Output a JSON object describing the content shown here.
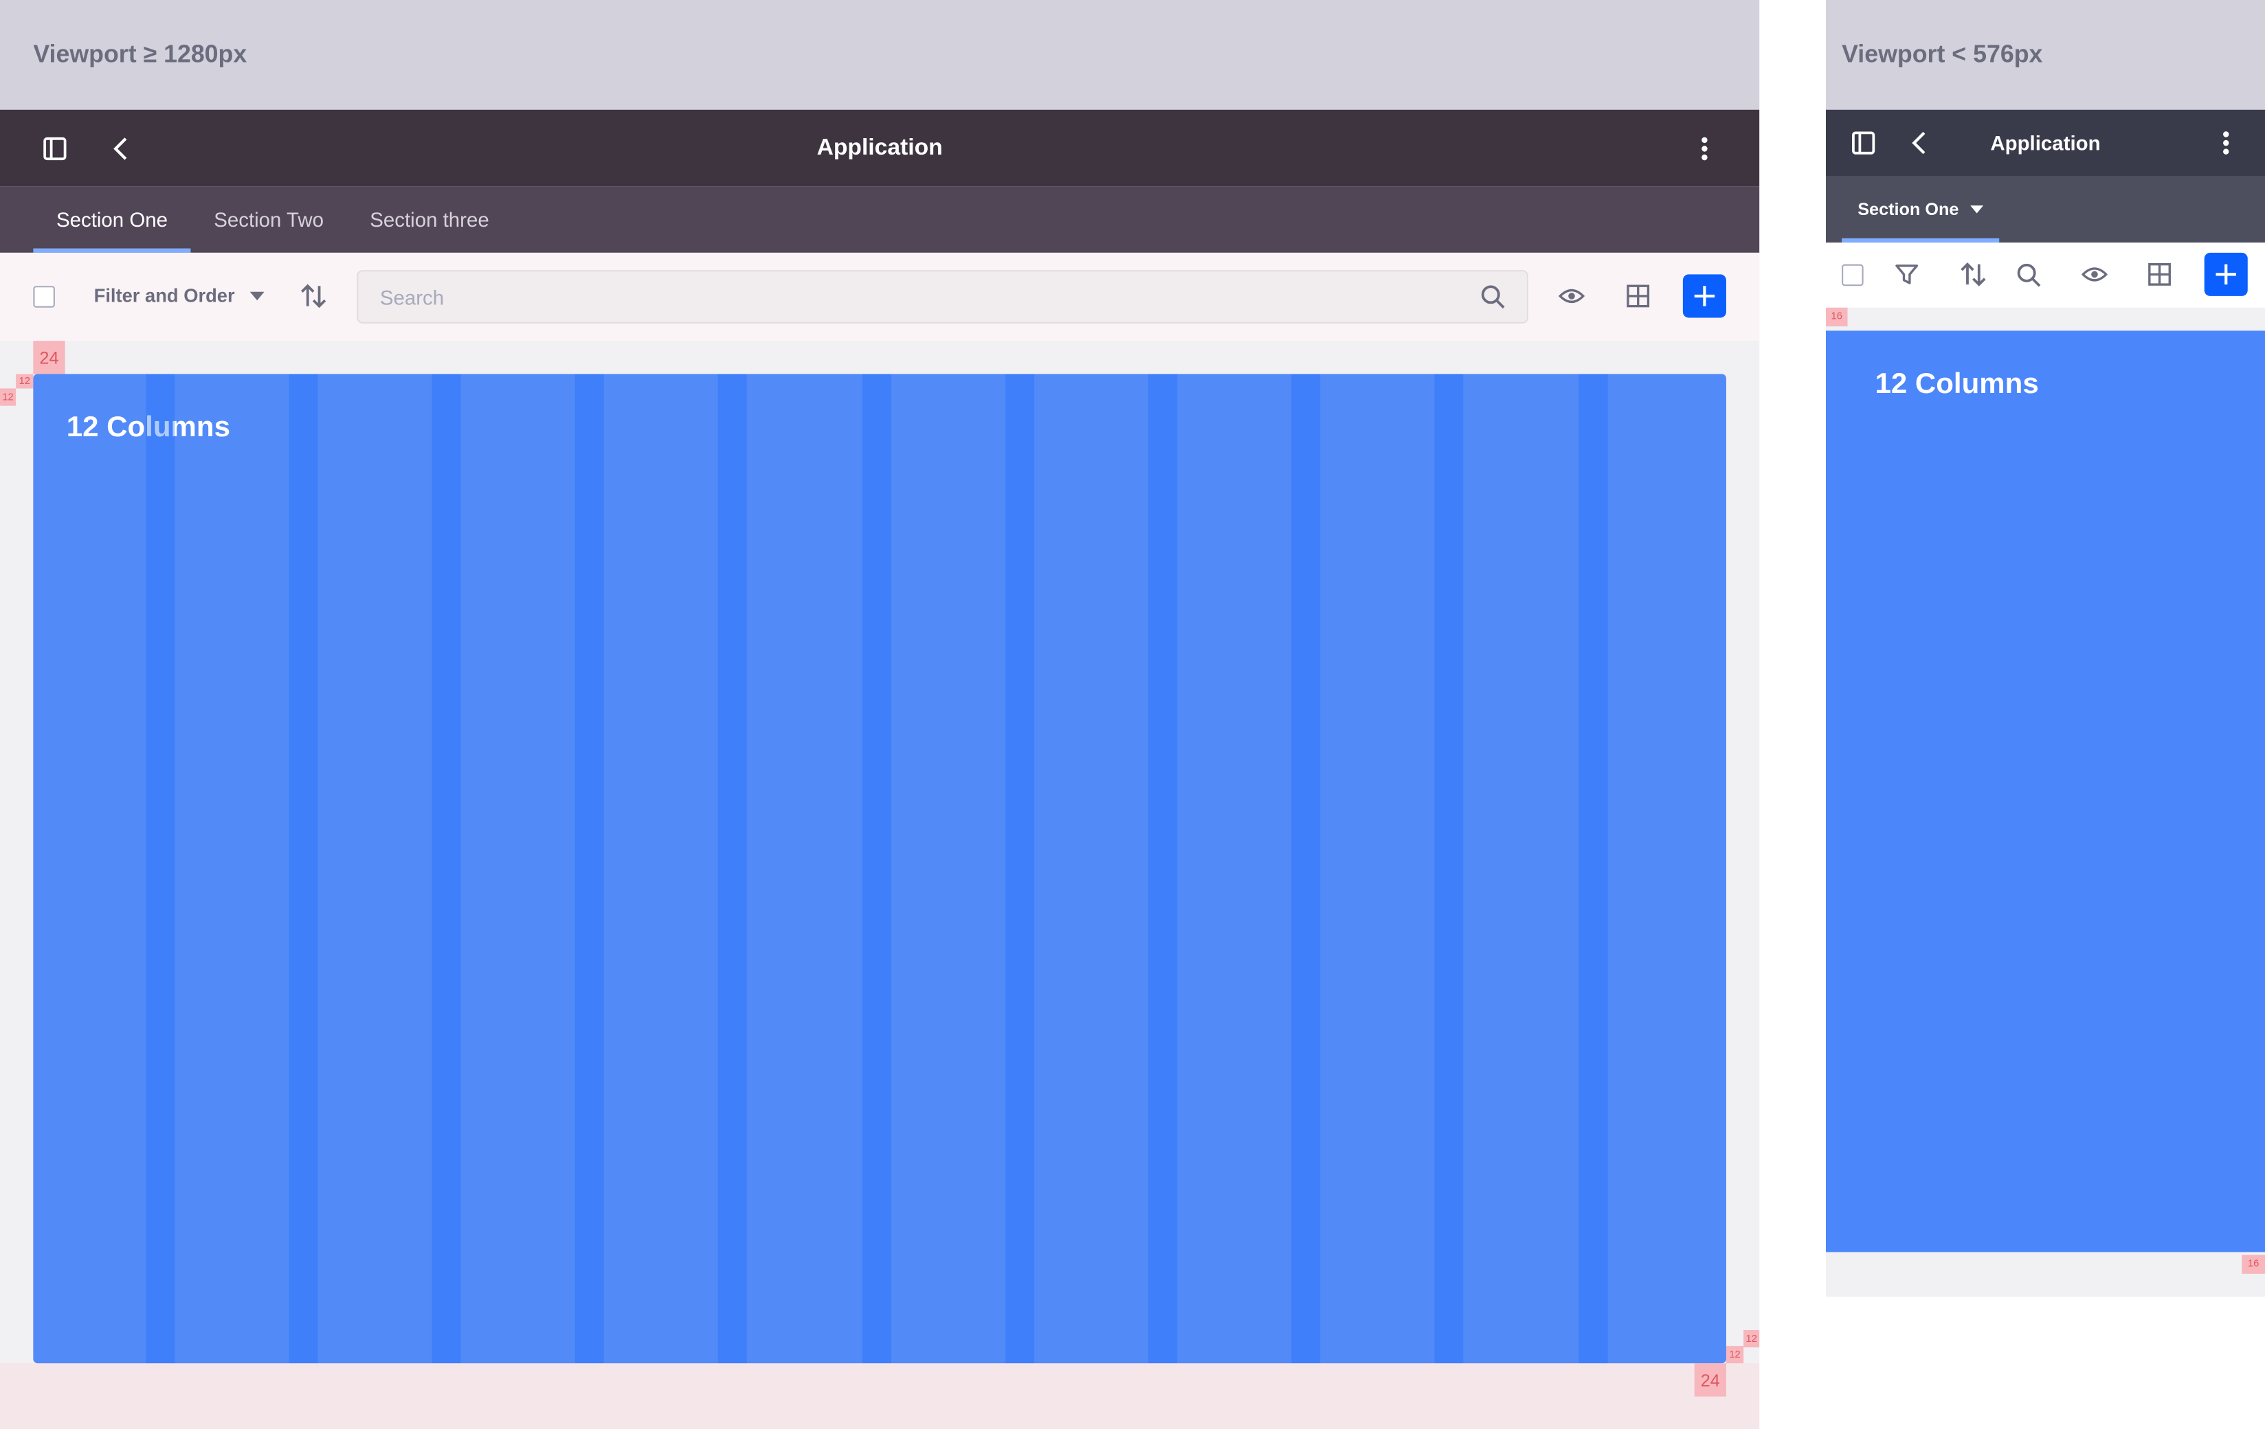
{
  "desktop": {
    "viewport_label": "Viewport ≥ 1280px",
    "app_title": "Application",
    "tabs": [
      {
        "label": "Section One",
        "active": true
      },
      {
        "label": "Section Two",
        "active": false
      },
      {
        "label": "Section three",
        "active": false
      }
    ],
    "toolbar": {
      "filter_label": "Filter and Order",
      "search_placeholder": "Search"
    },
    "content_title": "12 Columns",
    "measures": {
      "gutter_top": "24",
      "gutter_bottom": "24",
      "margin_left_a": "12",
      "margin_left_b": "12",
      "margin_right_a": "12",
      "margin_right_b": "12"
    }
  },
  "mobile": {
    "viewport_label": "Viewport  < 576px",
    "app_title": "Application",
    "tab_label": "Section One",
    "content_title": "12 Columns",
    "measures": {
      "top": "16",
      "bottom": "16"
    }
  },
  "colors": {
    "accent": "#0b5fff",
    "content_blue": "#528af8",
    "appbar": "#3d3440",
    "tabbar": "#514656"
  },
  "icons": [
    "sidebar-icon",
    "back-chevron-icon",
    "more-vertical-icon",
    "sort-icon",
    "search-icon",
    "eye-icon",
    "grid-view-icon",
    "plus-icon",
    "filter-icon",
    "caret-down-icon"
  ]
}
